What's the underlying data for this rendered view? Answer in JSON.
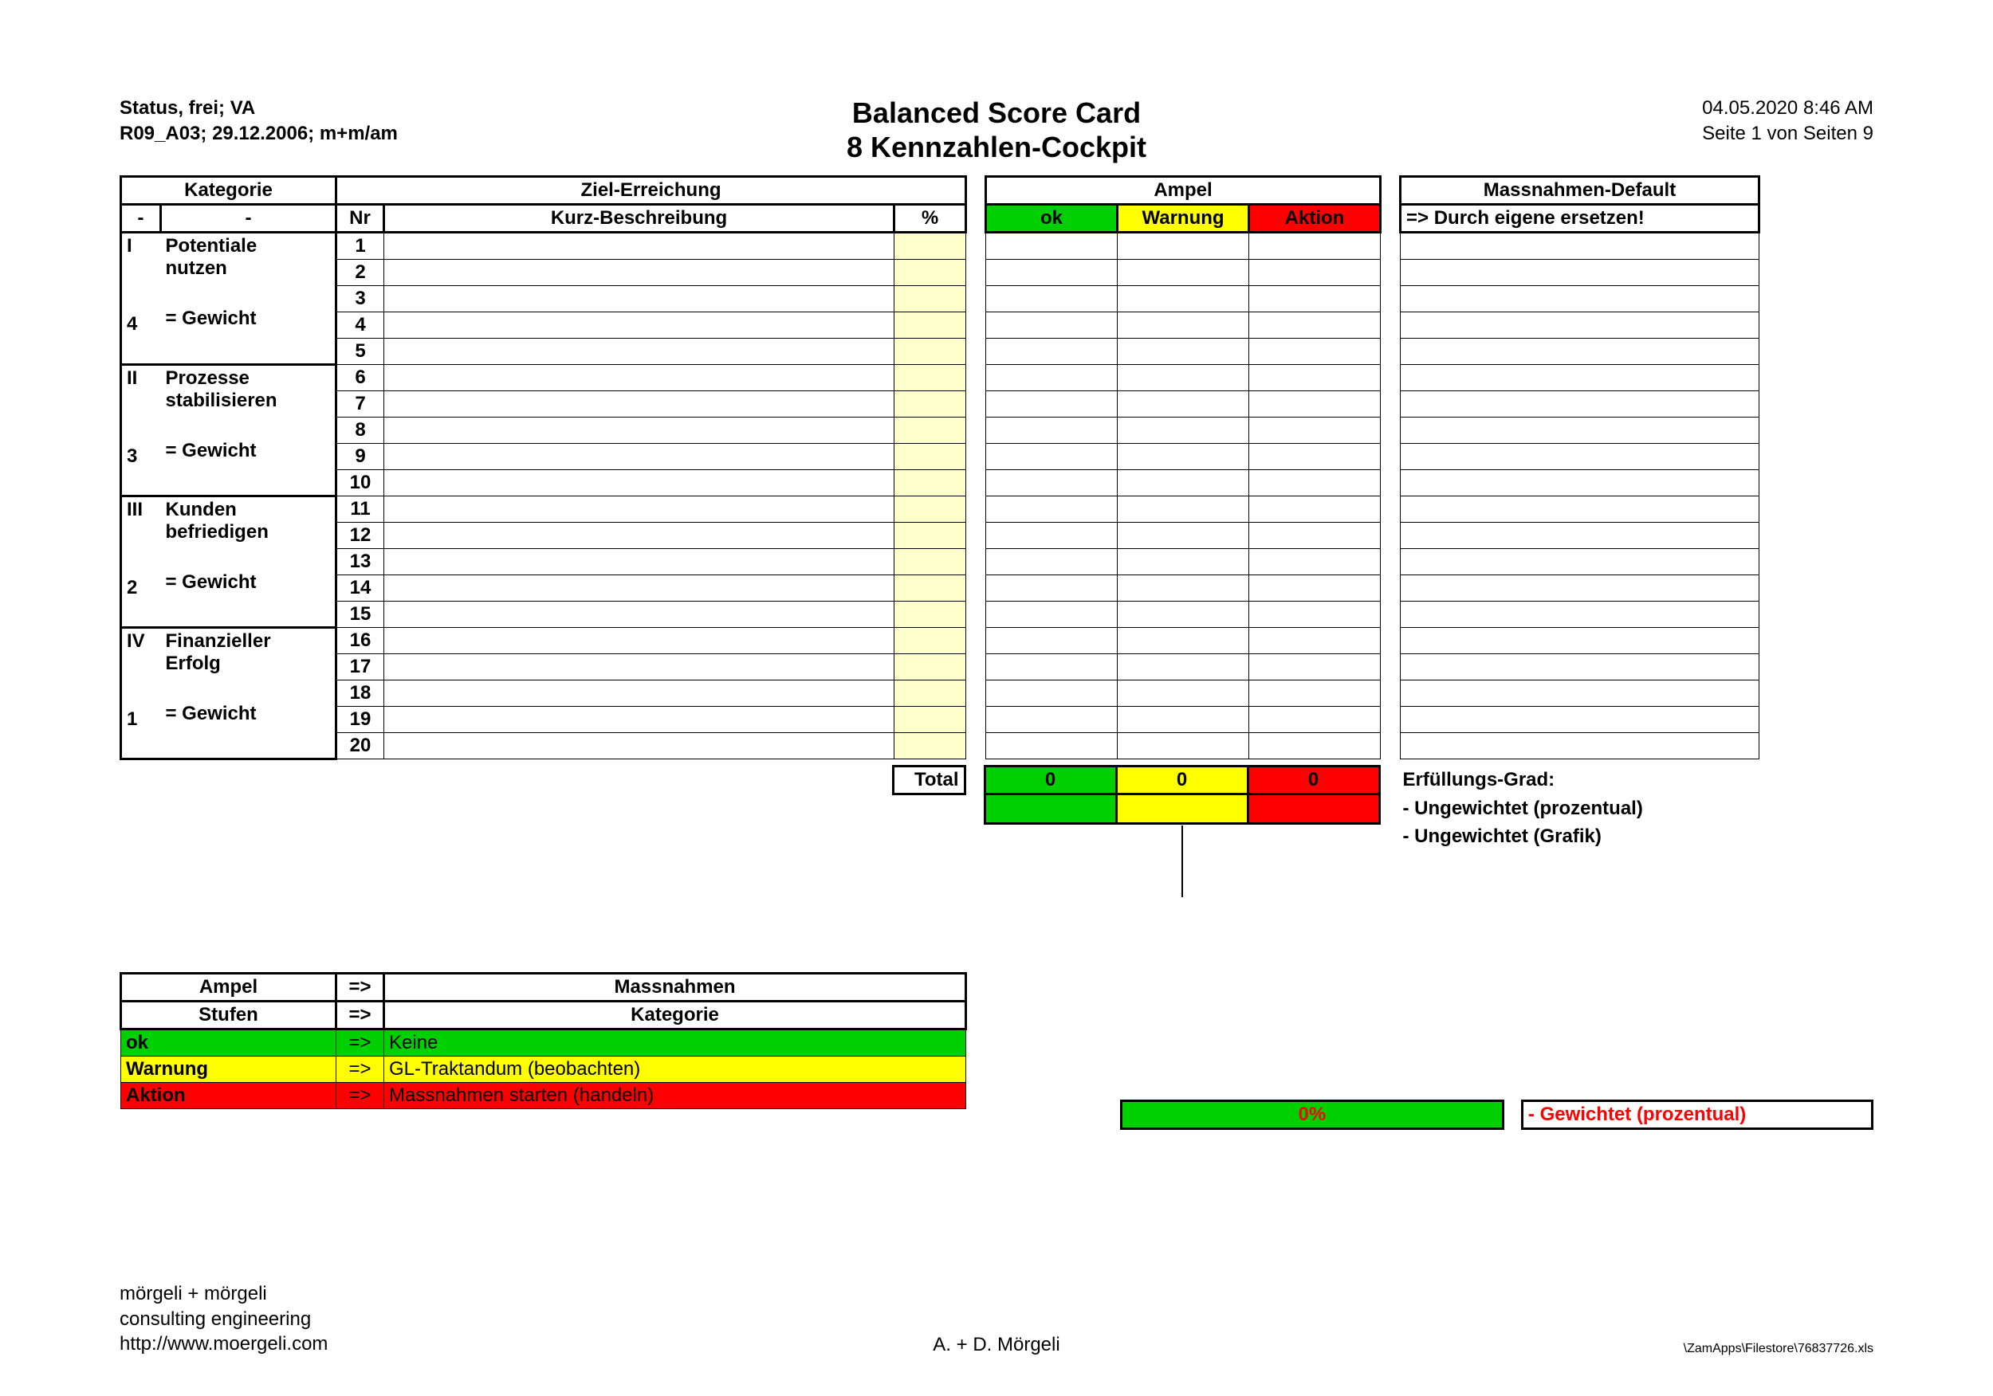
{
  "header": {
    "status": "Status, frei; VA",
    "rev": "R09_A03; 29.12.2006; m+m/am",
    "title1": "Balanced Score Card",
    "title2": "8  Kennzahlen-Cockpit",
    "datetime": "04.05.2020  8:46 AM",
    "page": "Seite 1 von Seiten 9"
  },
  "colhdr": {
    "kategorie": "Kategorie",
    "dash1": "-",
    "dash2": "-",
    "ziel": "Ziel-Erreichung",
    "nr": "Nr",
    "kurz": "Kurz-Beschreibung",
    "pct": "%",
    "ampel": "Ampel",
    "ok": "ok",
    "warn": "Warnung",
    "akt": "Aktion",
    "massn": "Massnahmen-Default",
    "massn2": "=> Durch eigene ersetzen!"
  },
  "categories": [
    {
      "num": "I",
      "line1": "Potentiale",
      "line2": "nutzen",
      "wnum": "4",
      "wlabel": "= Gewicht",
      "rows": [
        1,
        2,
        3,
        4,
        5
      ]
    },
    {
      "num": "II",
      "line1": "Prozesse",
      "line2": "stabilisieren",
      "wnum": "3",
      "wlabel": "= Gewicht",
      "rows": [
        6,
        7,
        8,
        9,
        10
      ]
    },
    {
      "num": "III",
      "line1": "Kunden",
      "line2": "befriedigen",
      "wnum": "2",
      "wlabel": "= Gewicht",
      "rows": [
        11,
        12,
        13,
        14,
        15
      ]
    },
    {
      "num": "IV",
      "line1": "Finanzieller",
      "line2": "Erfolg",
      "wnum": "1",
      "wlabel": "= Gewicht",
      "rows": [
        16,
        17,
        18,
        19,
        20
      ]
    }
  ],
  "total": {
    "label": "Total",
    "ok": "0",
    "warn": "0",
    "akt": "0"
  },
  "erf": {
    "title": "Erfüllungs-Grad:",
    "u1": "-  Ungewichtet (prozentual)",
    "u2": "-  Ungewichtet (Grafik)",
    "g1": "-  Gewichtet (prozentual)"
  },
  "legend": {
    "ampel": "Ampel",
    "stufen": "Stufen",
    "arrow": "=>",
    "massn": "Massnahmen",
    "kat": "Kategorie",
    "ok": "ok",
    "ok_m": "Keine",
    "warn": "Warnung",
    "warn_m": "GL-Traktandum (beobachten)",
    "akt": "Aktion",
    "akt_m": "Massnahmen starten (handeln)"
  },
  "pctbar": "0%",
  "footer": {
    "l1": "mörgeli + mörgeli",
    "l2": "consulting engineering",
    "l3": "http://www.moergeli.com",
    "center": "A. + D. Mörgeli",
    "right": "\\ZamApps\\Filestore\\76837726.xls"
  }
}
